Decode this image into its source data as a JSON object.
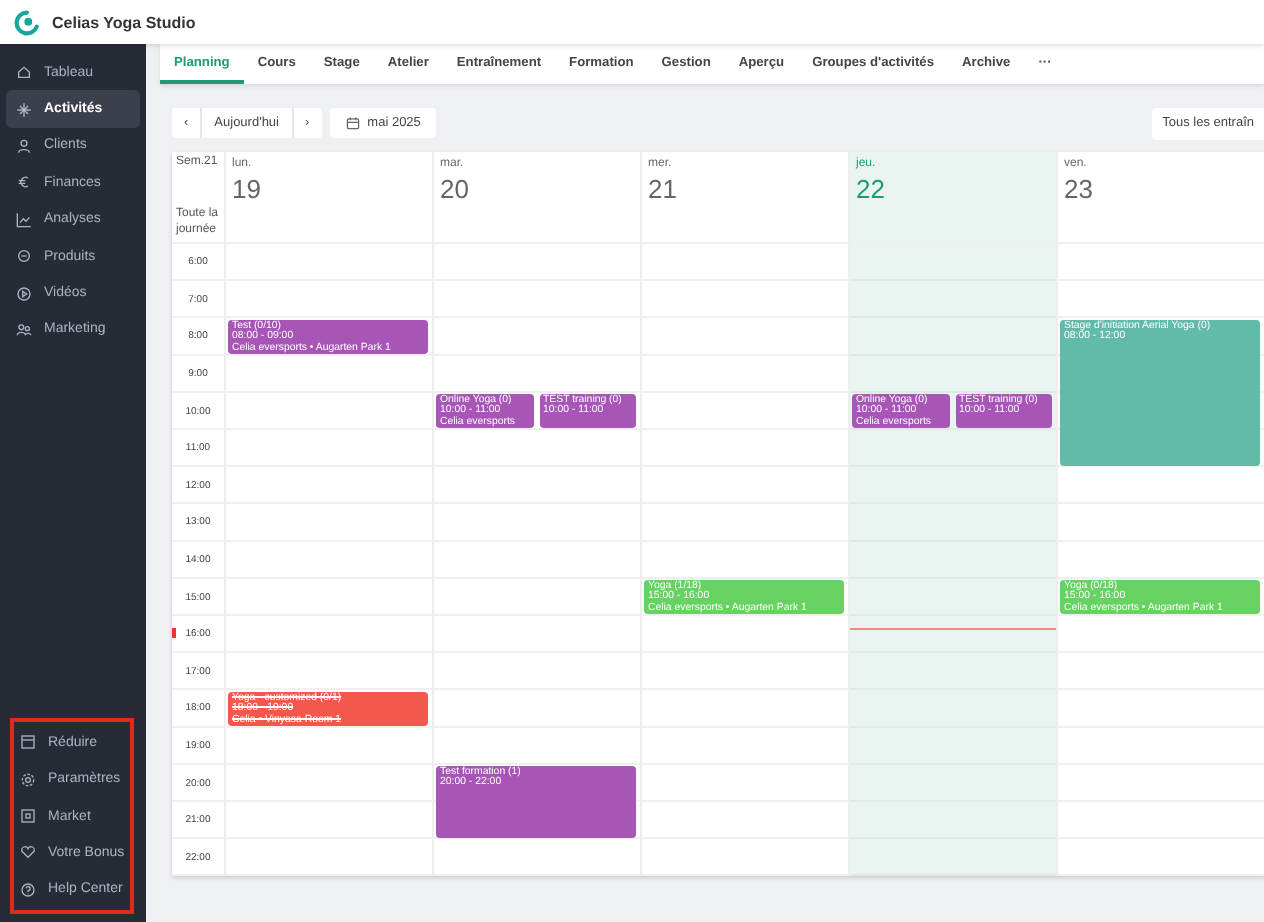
{
  "app": {
    "title": "Celias Yoga Studio"
  },
  "sidebar": {
    "items": [
      {
        "label": "Tableau",
        "selected": false
      },
      {
        "label": "Activités",
        "selected": true
      },
      {
        "label": "Clients",
        "selected": false
      },
      {
        "label": "Finances",
        "selected": false
      },
      {
        "label": "Analyses",
        "selected": false
      },
      {
        "label": "Produits",
        "selected": false
      },
      {
        "label": "Vidéos",
        "selected": false
      },
      {
        "label": "Marketing",
        "selected": false
      }
    ],
    "bottom_highlighted": true,
    "bottom_items": [
      {
        "label": "Réduire"
      },
      {
        "label": "Paramètres"
      },
      {
        "label": "Market"
      },
      {
        "label": "Votre Bonus"
      },
      {
        "label": "Help Center"
      }
    ]
  },
  "tabs": [
    {
      "label": "Planning",
      "selected": true
    },
    {
      "label": "Cours",
      "selected": false
    },
    {
      "label": "Stage",
      "selected": false
    },
    {
      "label": "Atelier",
      "selected": false
    },
    {
      "label": "Entraînement",
      "selected": false
    },
    {
      "label": "Formation",
      "selected": false
    },
    {
      "label": "Gestion",
      "selected": false
    },
    {
      "label": "Aperçu",
      "selected": false
    },
    {
      "label": "Groupes d'activités",
      "selected": false
    },
    {
      "label": "Archive",
      "selected": false
    },
    {
      "label": "···",
      "selected": false
    }
  ],
  "toolbar": {
    "prev": "‹",
    "today": "Aujourd'hui",
    "next": "›",
    "month": "mai 2025",
    "filter": "Tous les entraîn"
  },
  "calendar": {
    "week": "Sem.21",
    "all_day": "Toute la journée",
    "hours": [
      "6:00",
      "7:00",
      "8:00",
      "9:00",
      "10:00",
      "11:00",
      "12:00",
      "13:00",
      "14:00",
      "15:00",
      "16:00",
      "17:00",
      "18:00",
      "19:00",
      "20:00",
      "21:00",
      "22:00"
    ],
    "days": [
      {
        "weekday": "lun.",
        "date": "19",
        "today": false,
        "events": [
          {
            "title": "Test (0/10)",
            "time": "08:00 - 09:00",
            "place": "Celia eversports • Augarten Park 1",
            "color": "#a855b8",
            "cancelled": false
          },
          {
            "title": "Yoga - customized (0/1)",
            "time": "18:00 - 19:00",
            "place": "Celia • Vinyasa Room 1",
            "color": "#f4574c",
            "cancelled": true
          }
        ]
      },
      {
        "weekday": "mar.",
        "date": "20",
        "today": false,
        "events": [
          {
            "title": "Online Yoga (0)",
            "time": "10:00 - 11:00",
            "place": "Celia eversports",
            "color": "#a855b8",
            "cancelled": false
          },
          {
            "title": "TEST training (0)",
            "time": "10:00 - 11:00",
            "color": "#a855b8",
            "cancelled": false
          },
          {
            "title": "Test formation (1)",
            "time": "20:00 - 22:00",
            "color": "#a855b8",
            "cancelled": false
          }
        ]
      },
      {
        "weekday": "mer.",
        "date": "21",
        "today": false,
        "events": [
          {
            "title": "Yoga (1/18)",
            "time": "15:00 - 16:00",
            "place": "Celia eversports • Augarten Park 1",
            "color": "#67d162",
            "cancelled": false
          }
        ]
      },
      {
        "weekday": "jeu.",
        "date": "22",
        "today": true,
        "events": [
          {
            "title": "Online Yoga (0)",
            "time": "10:00 - 11:00",
            "place": "Celia eversports",
            "color": "#a855b8",
            "cancelled": false
          },
          {
            "title": "TEST training (0)",
            "time": "10:00 - 11:00",
            "color": "#a855b8",
            "cancelled": false
          }
        ]
      },
      {
        "weekday": "ven.",
        "date": "23",
        "today": false,
        "events": [
          {
            "title": "Stage d'initiation Aerial Yoga (0)",
            "time": "08:00 - 12:00",
            "color": "#62bba9",
            "cancelled": false
          },
          {
            "title": "Yoga (0/18)",
            "time": "15:00 - 16:00",
            "place": "Celia eversports • Augarten Park 1",
            "color": "#67d162",
            "cancelled": false
          }
        ]
      }
    ]
  }
}
